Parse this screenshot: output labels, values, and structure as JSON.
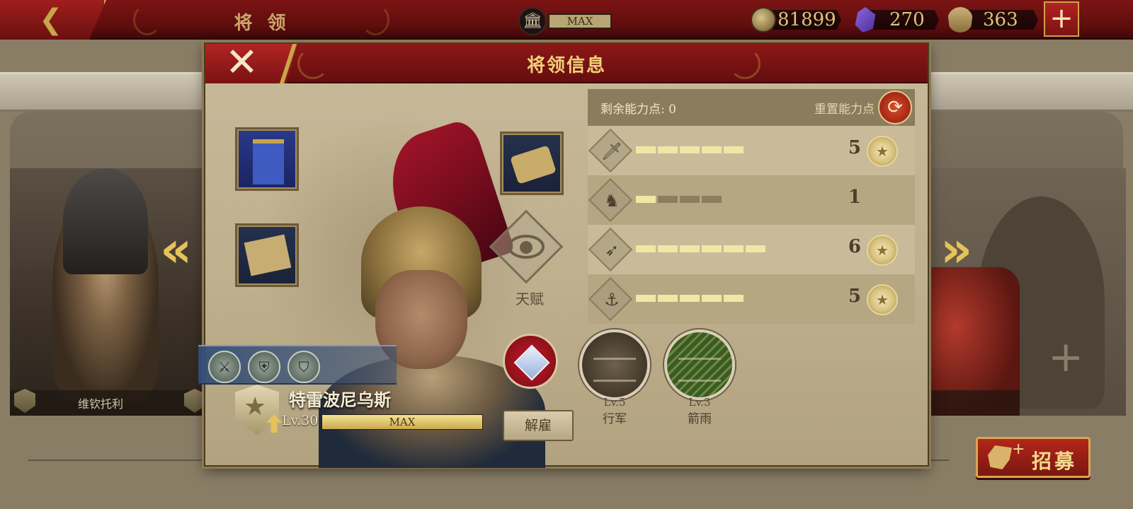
{
  "topbar": {
    "screen_title": "将 领",
    "capacity": "MAX",
    "gold": "81899",
    "gems": "270",
    "spqr": "363",
    "plus": "+"
  },
  "side_left": {
    "name": "维钦托利"
  },
  "recruit": {
    "label": "招募",
    "plus": "+"
  },
  "dialog": {
    "title": "将领信息",
    "close": "✕",
    "talent_label": "天赋",
    "general_name": "特雷波尼乌斯",
    "level": "Lv.30",
    "level_bar_text": "MAX",
    "level_progress": 1.0,
    "dismiss": "解雇",
    "skill_badges": [
      "⚔",
      "⛨",
      "⛉"
    ],
    "points_label": "剩余能力点:  0",
    "reset_label": "重置能力点",
    "reset_icon": "⟳"
  },
  "stats": [
    {
      "icon": "sword-icon",
      "glyph": "🗡",
      "value": "5",
      "on": 5,
      "total": 5,
      "medal": true
    },
    {
      "icon": "horse-icon",
      "glyph": "♞",
      "value": "1",
      "on": 1,
      "total": 4,
      "medal": false
    },
    {
      "icon": "bow-icon",
      "glyph": "➶",
      "value": "6",
      "on": 6,
      "total": 6,
      "medal": true
    },
    {
      "icon": "anchor-icon",
      "glyph": "⚓",
      "value": "5",
      "on": 5,
      "total": 5,
      "medal": true
    }
  ],
  "abilities": [
    {
      "level": "Lv.5",
      "name": "行军"
    },
    {
      "level": "Lv.3",
      "name": "箭雨"
    }
  ]
}
